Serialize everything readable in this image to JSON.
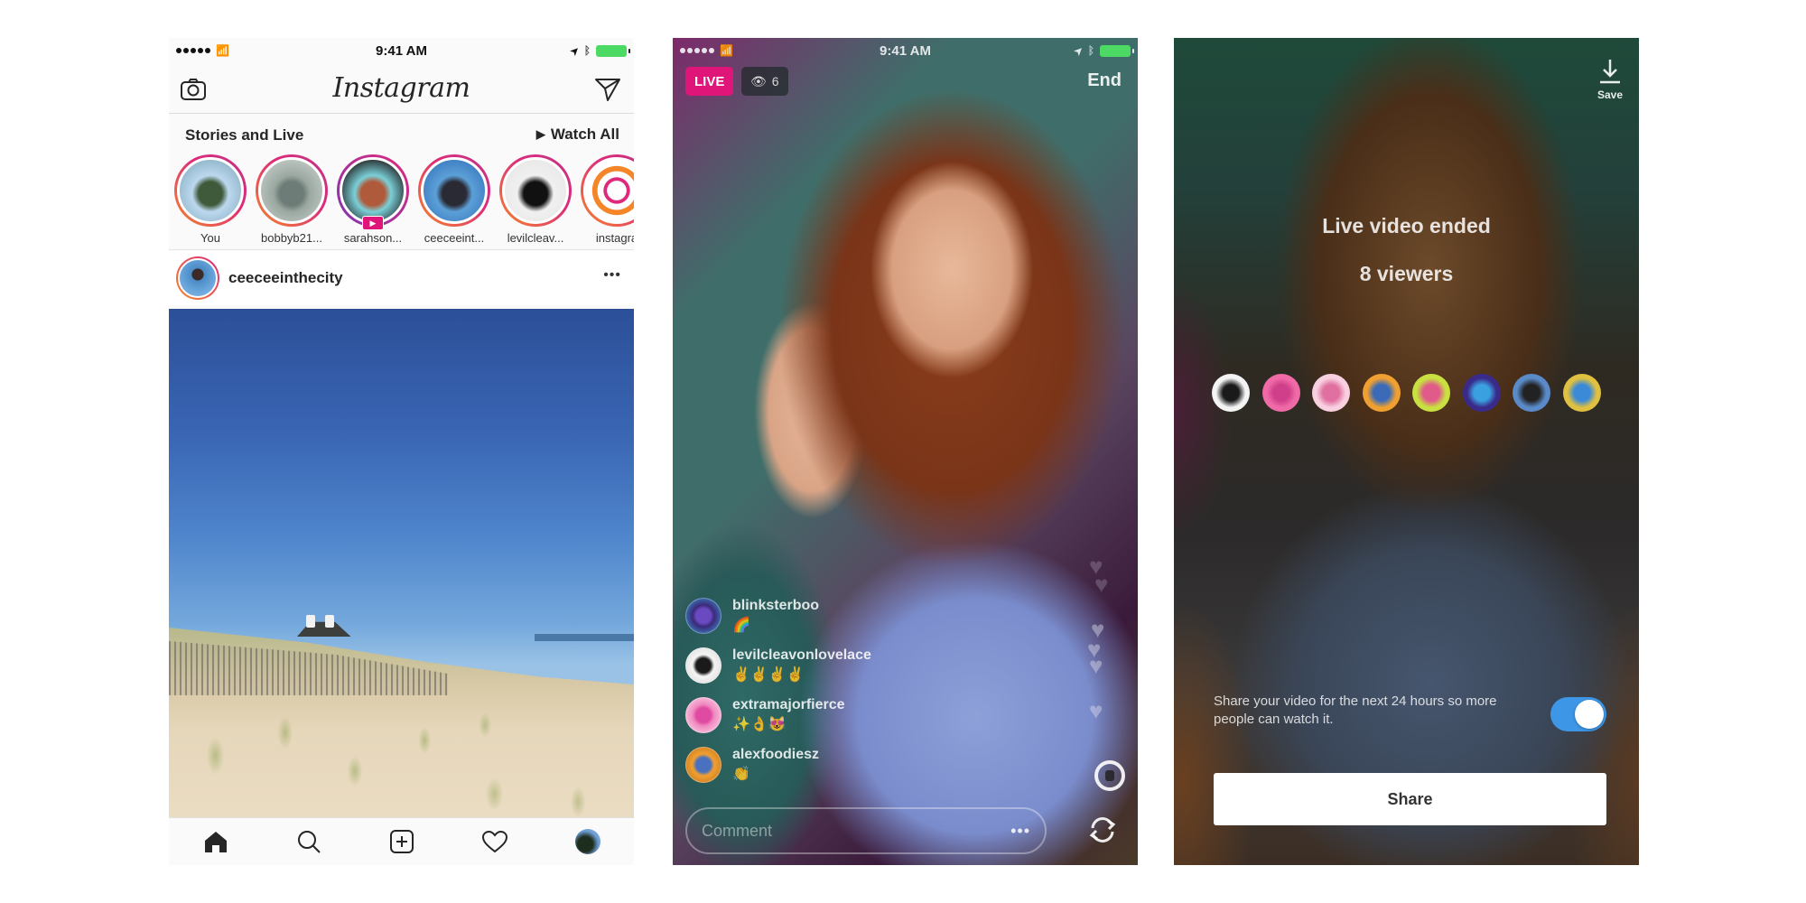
{
  "status_bar": {
    "time": "9:41 AM"
  },
  "feed": {
    "logo": "Instagram",
    "stories_title": "Stories and Live",
    "watch_all": "Watch All",
    "stories": [
      {
        "label": "You",
        "live": false,
        "colors": [
          "#bcd8ee",
          "#3f5a3a",
          "#8fb4c8"
        ]
      },
      {
        "label": "bobbyb21...",
        "live": false,
        "colors": [
          "#9aa8a0",
          "#6e7c78",
          "#c0c8c4"
        ]
      },
      {
        "label": "sarahson...",
        "live": true,
        "colors": [
          "#7ad0d8",
          "#b05a3c",
          "#222222"
        ]
      },
      {
        "label": "ceeceeint...",
        "live": false,
        "colors": [
          "#5ca0d8",
          "#2a2a34",
          "#3b7cc0"
        ]
      },
      {
        "label": "levilcleav...",
        "live": false,
        "colors": [
          "#f0f0f0",
          "#111111",
          "#e8e8e8"
        ]
      },
      {
        "label": "instagra",
        "live": false,
        "colors": [
          "#ffffff",
          "#c13584",
          "#f58529"
        ]
      }
    ],
    "post": {
      "username": "ceeceeinthecity",
      "more": "•••"
    },
    "tabs": [
      {
        "name": "home",
        "active": true
      },
      {
        "name": "search",
        "active": false
      },
      {
        "name": "new-post",
        "active": false
      },
      {
        "name": "activity",
        "active": false
      },
      {
        "name": "profile",
        "active": false
      }
    ]
  },
  "live": {
    "live_label": "LIVE",
    "viewer_count": "6",
    "end_label": "End",
    "comments": [
      {
        "username": "blinksterboo",
        "text": "🌈",
        "avatar_colors": [
          "#3b2a7a",
          "#6a4ac0",
          "#3a90c8"
        ]
      },
      {
        "username": "levilcleavonlovelace",
        "text": "✌️✌️✌️✌️",
        "avatar_colors": [
          "#f4f4f4",
          "#1a1a1a",
          "#dddddd"
        ]
      },
      {
        "username": "extramajorfierce",
        "text": "✨👌😻",
        "avatar_colors": [
          "#f08ac0",
          "#e04aa0",
          "#f8d0e4"
        ]
      },
      {
        "username": "alexfoodiesz",
        "text": "👏",
        "avatar_colors": [
          "#f0a030",
          "#4a70c0",
          "#c87820"
        ]
      }
    ],
    "comment_placeholder": "Comment",
    "comment_more": "•••"
  },
  "ended": {
    "save_label": "Save",
    "title": "Live video ended",
    "viewers_label": "8 viewers",
    "viewer_avatars": [
      [
        "#f4f4f4",
        "#1a1a1a"
      ],
      [
        "#f06aa8",
        "#d0408a"
      ],
      [
        "#f8d0e0",
        "#e070a0"
      ],
      [
        "#f0a030",
        "#3a6ab8"
      ],
      [
        "#c8e040",
        "#e05a8a"
      ],
      [
        "#3a2a8a",
        "#3aa0e0"
      ],
      [
        "#5a8ac8",
        "#222222"
      ],
      [
        "#e0c040",
        "#3a8ad8"
      ]
    ],
    "share_text": "Share your video for the next 24 hours so more people can watch it.",
    "share_toggle_on": true,
    "share_button": "Share"
  },
  "colors": {
    "live_pink": "#e0157a",
    "toggle_blue": "#3d97e6",
    "battery_green": "#4cd964"
  }
}
